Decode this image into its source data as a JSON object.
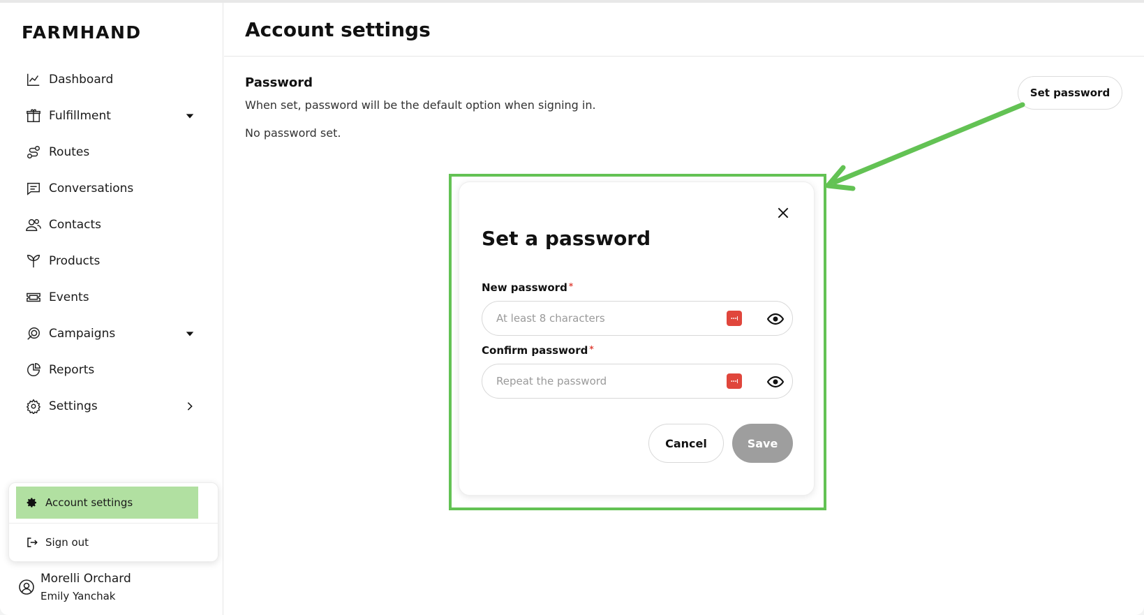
{
  "app": {
    "logo": "FARMHAND"
  },
  "sidebar": {
    "items": [
      {
        "label": "Dashboard",
        "icon": "chart-line-icon"
      },
      {
        "label": "Fulfillment",
        "icon": "box-icon",
        "trail": "caret-down"
      },
      {
        "label": "Routes",
        "icon": "route-icon"
      },
      {
        "label": "Conversations",
        "icon": "message-icon"
      },
      {
        "label": "Contacts",
        "icon": "users-icon"
      },
      {
        "label": "Products",
        "icon": "sprout-icon"
      },
      {
        "label": "Events",
        "icon": "ticket-icon"
      },
      {
        "label": "Campaigns",
        "icon": "megaphone-icon",
        "trail": "caret-down"
      },
      {
        "label": "Reports",
        "icon": "pie-chart-icon"
      },
      {
        "label": "Settings",
        "icon": "gear-icon",
        "trail": "chevron-right"
      }
    ]
  },
  "user_menu": {
    "account_settings": "Account settings",
    "sign_out": "Sign out"
  },
  "user": {
    "org": "Morelli Orchard",
    "name": "Emily Yanchak"
  },
  "main": {
    "title": "Account settings",
    "section_title": "Password",
    "section_desc": "When set, password will be the default option when signing in.",
    "status": "No password set.",
    "set_password_button": "Set password"
  },
  "modal": {
    "title": "Set a password",
    "new_password_label": "New password",
    "new_password_placeholder": "At least 8 characters",
    "confirm_password_label": "Confirm password",
    "confirm_password_placeholder": "Repeat the password",
    "required_mark": "*",
    "cancel": "Cancel",
    "save": "Save"
  },
  "colors": {
    "highlight": "#63c254",
    "active_menu": "#b1e0a1",
    "save_disabled": "#9e9e9e",
    "required": "#e0463c"
  }
}
